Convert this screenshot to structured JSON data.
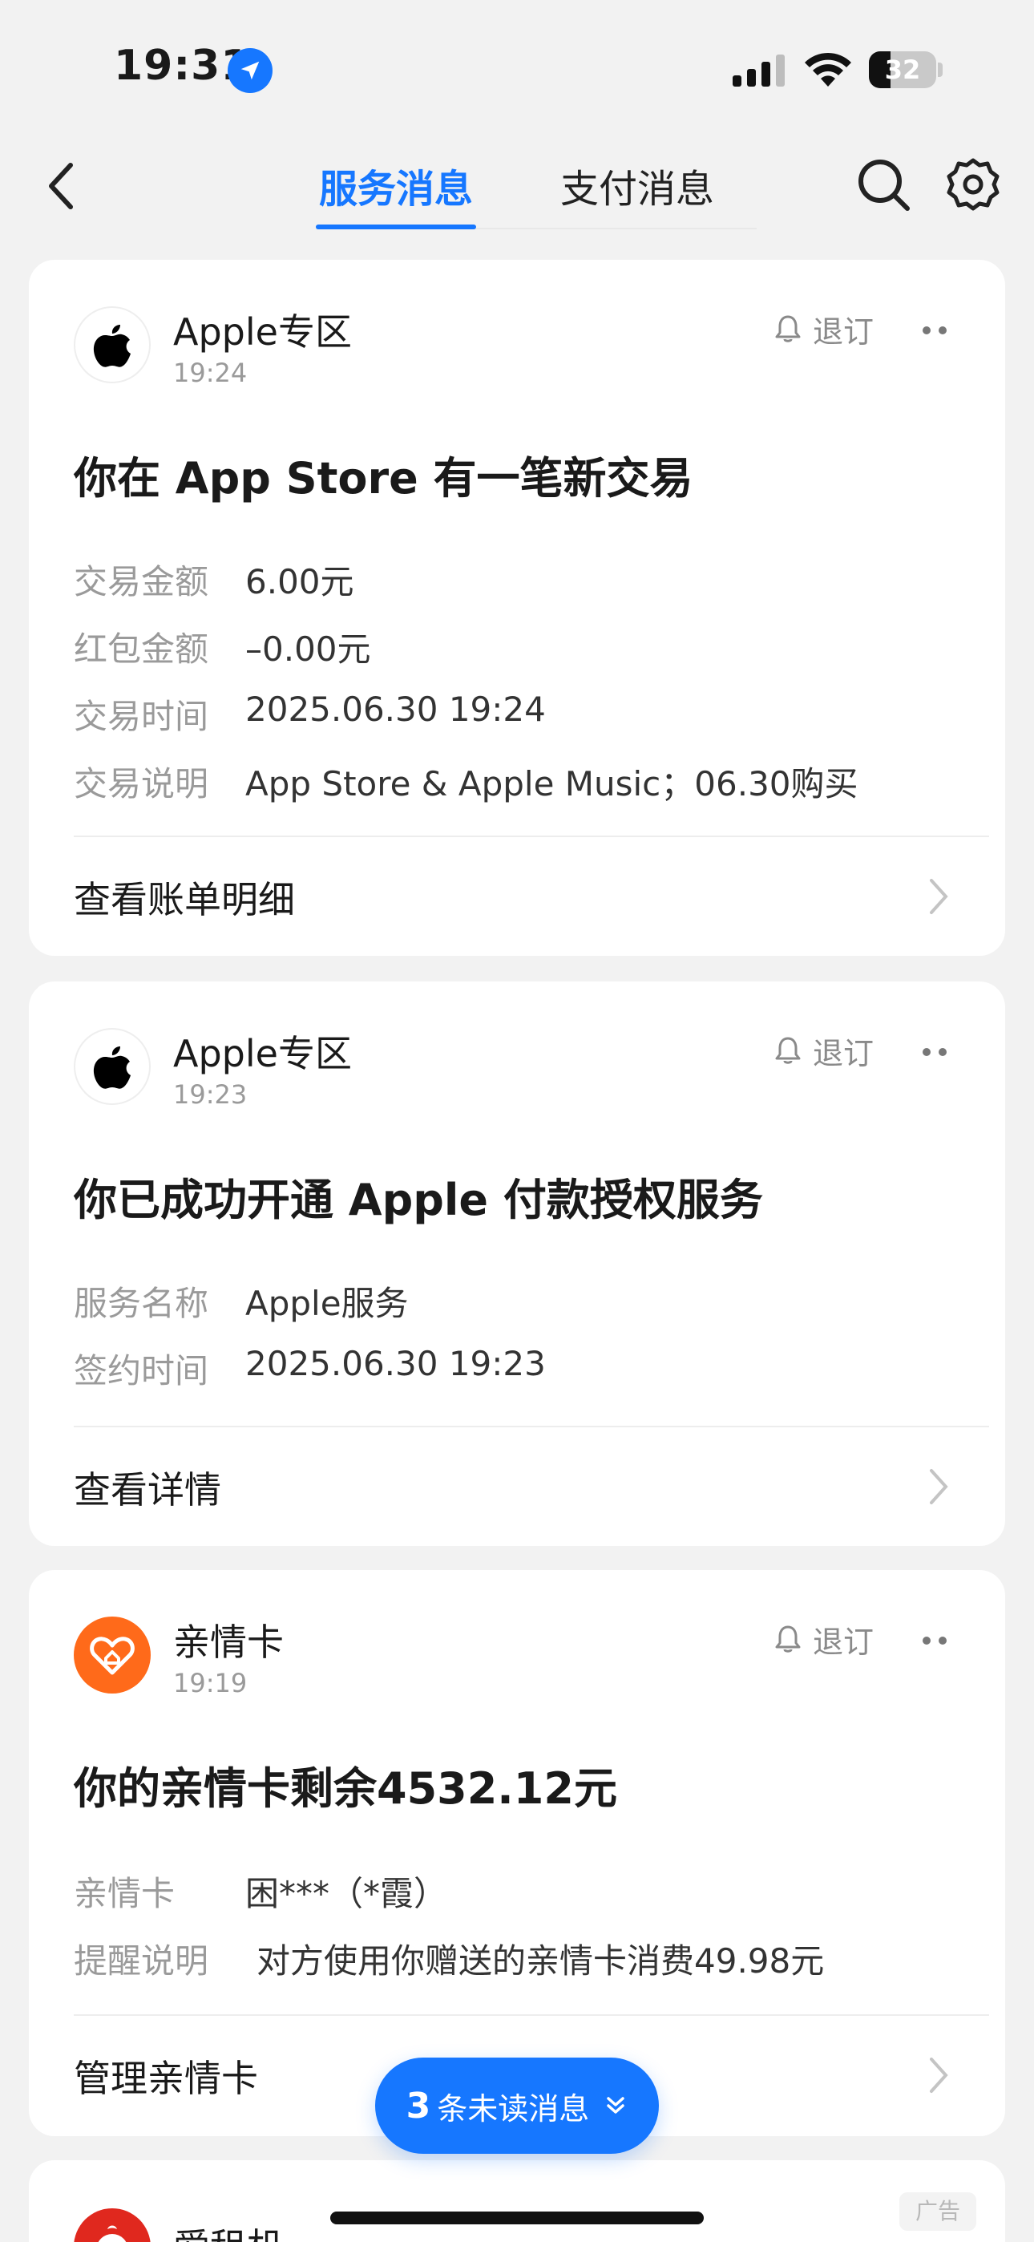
{
  "status_bar": {
    "time": "19:31",
    "battery": "32",
    "battery_level": 0.32
  },
  "nav": {
    "tabs": [
      "服务消息",
      "支付消息"
    ],
    "active_tab": 0
  },
  "messages": [
    {
      "source": "Apple专区",
      "time": "19:24",
      "unsubscribe": "退订",
      "title": "你在 App Store 有一笔新交易",
      "rows": [
        {
          "label": "交易金额",
          "value": "6.00元"
        },
        {
          "label": "红包金额",
          "value": "–0.00元"
        },
        {
          "label": "交易时间",
          "value": "2025.06.30 19:24"
        },
        {
          "label": "交易说明",
          "value": "App Store & Apple Music；06.30购买"
        }
      ],
      "footer": "查看账单明细"
    },
    {
      "source": "Apple专区",
      "time": "19:23",
      "unsubscribe": "退订",
      "title": "你已成功开通 Apple 付款授权服务",
      "rows": [
        {
          "label": "服务名称",
          "value": "Apple服务"
        },
        {
          "label": "签约时间",
          "value": "2025.06.30 19:23"
        }
      ],
      "footer": "查看详情"
    },
    {
      "source": "亲情卡",
      "time": "19:19",
      "unsubscribe": "退订",
      "title": "你的亲情卡剩余4532.12元",
      "rows": [
        {
          "label": "亲情卡",
          "value": "困***（*霞）"
        },
        {
          "label": "提醒说明",
          "value": "对方使用你赠送的亲情卡消费49.98元"
        }
      ],
      "footer": "管理亲情卡"
    },
    {
      "source": "爱租机",
      "ad_label": "广告"
    }
  ],
  "unread": {
    "count": "3",
    "label": "条未读消息"
  },
  "colors": {
    "accent": "#1677ff",
    "background": "#f2f2f2",
    "card": "#ffffff",
    "family_card": "#ff6a1a",
    "rental": "#e0281e"
  },
  "icons": [
    "location-arrow-icon",
    "signal-icon",
    "wifi-icon",
    "battery-icon",
    "back-arrow-icon",
    "search-icon",
    "gear-icon",
    "apple-logo-icon",
    "bell-icon",
    "more-dots-icon",
    "chevron-right-icon",
    "family-card-heart-icon",
    "rental-mascot-icon",
    "double-chevron-down-icon"
  ]
}
